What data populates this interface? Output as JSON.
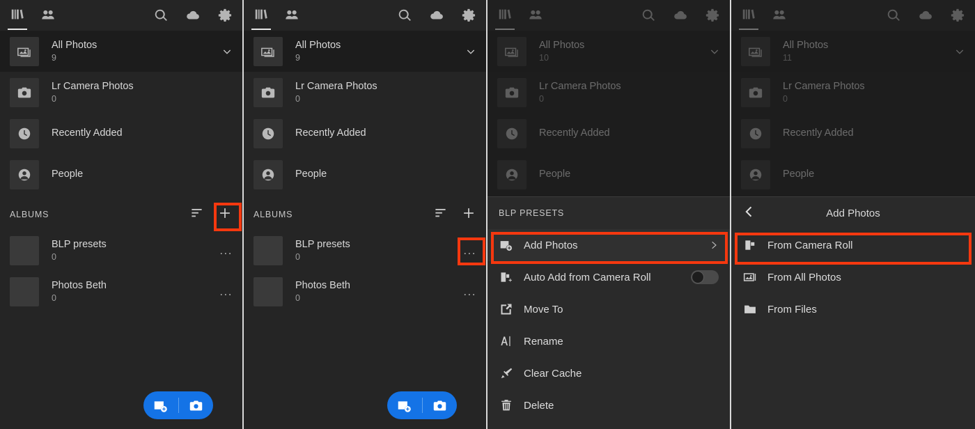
{
  "app": {
    "accent_blue": "#1473e6",
    "annotation_red": "#f5380f",
    "background": "#252525"
  },
  "topbar": {
    "tabs": [
      {
        "name": "library-tab",
        "icon": "library-icon",
        "active": true
      },
      {
        "name": "sharing-tab",
        "icon": "people-icon",
        "active": false
      }
    ],
    "actions": [
      {
        "name": "search-button",
        "icon": "search-icon"
      },
      {
        "name": "cloud-button",
        "icon": "cloud-icon"
      },
      {
        "name": "settings-button",
        "icon": "gear-icon"
      }
    ]
  },
  "panels": [
    {
      "id": "panel-1",
      "dimmed": false,
      "library": {
        "rows": [
          {
            "title": "All Photos",
            "count": "9",
            "icon": "photo-icon",
            "selected": true,
            "expandable": true
          },
          {
            "title": "Lr Camera Photos",
            "count": "0",
            "icon": "camera-icon",
            "selected": false,
            "expandable": false
          },
          {
            "title": "Recently Added",
            "count": "",
            "icon": "clock-icon",
            "selected": false,
            "expandable": false
          },
          {
            "title": "People",
            "count": "",
            "icon": "person-icon",
            "selected": false,
            "expandable": false
          }
        ]
      },
      "albums": {
        "label": "ALBUMS",
        "sort_icon": "sort-icon",
        "add_icon": "plus-icon",
        "items": [
          {
            "title": "BLP presets",
            "count": "0",
            "overflow": "..."
          },
          {
            "title": "Photos Beth",
            "count": "0",
            "overflow": "..."
          }
        ]
      },
      "fab": {
        "add_photos_icon": "add-photo-icon",
        "camera_icon": "camera-icon"
      },
      "highlight": {
        "target": "albums-add-button"
      }
    },
    {
      "id": "panel-2",
      "dimmed": false,
      "library": {
        "rows": [
          {
            "title": "All Photos",
            "count": "9",
            "icon": "photo-icon",
            "selected": true,
            "expandable": true
          },
          {
            "title": "Lr Camera Photos",
            "count": "0",
            "icon": "camera-icon",
            "selected": false,
            "expandable": false
          },
          {
            "title": "Recently Added",
            "count": "",
            "icon": "clock-icon",
            "selected": false,
            "expandable": false
          },
          {
            "title": "People",
            "count": "",
            "icon": "person-icon",
            "selected": false,
            "expandable": false
          }
        ]
      },
      "albums": {
        "label": "ALBUMS",
        "sort_icon": "sort-icon",
        "add_icon": "plus-icon",
        "items": [
          {
            "title": "BLP presets",
            "count": "0",
            "overflow": "..."
          },
          {
            "title": "Photos Beth",
            "count": "0",
            "overflow": "..."
          }
        ]
      },
      "fab": {
        "add_photos_icon": "add-photo-icon",
        "camera_icon": "camera-icon"
      },
      "highlight": {
        "target": "album-overflow-button-blp-presets"
      }
    },
    {
      "id": "panel-3",
      "dimmed": true,
      "library": {
        "rows": [
          {
            "title": "All Photos",
            "count": "10",
            "icon": "photo-icon",
            "selected": true,
            "expandable": true
          },
          {
            "title": "Lr Camera Photos",
            "count": "0",
            "icon": "camera-icon",
            "selected": false,
            "expandable": false
          },
          {
            "title": "Recently Added",
            "count": "",
            "icon": "clock-icon",
            "selected": false,
            "expandable": false
          },
          {
            "title": "People",
            "count": "",
            "icon": "person-icon",
            "selected": false,
            "expandable": false
          }
        ]
      },
      "menu": {
        "title": "BLP PRESETS",
        "items": [
          {
            "label": "Add Photos",
            "icon": "add-photo-icon",
            "trailing": "chevron-right",
            "highlighted": true
          },
          {
            "label": "Auto Add from Camera Roll",
            "icon": "auto-add-camera-roll-icon",
            "trailing": "toggle-off",
            "highlighted": false
          },
          {
            "label": "Move To",
            "icon": "move-to-icon",
            "trailing": "none",
            "highlighted": false
          },
          {
            "label": "Rename",
            "icon": "rename-icon",
            "trailing": "none",
            "highlighted": false
          },
          {
            "label": "Clear Cache",
            "icon": "clear-cache-icon",
            "trailing": "none",
            "highlighted": false
          },
          {
            "label": "Delete",
            "icon": "trash-icon",
            "trailing": "none",
            "highlighted": false
          }
        ]
      },
      "highlight": {
        "target": "menu-item-add-photos"
      }
    },
    {
      "id": "panel-4",
      "dimmed": true,
      "library": {
        "rows": [
          {
            "title": "All Photos",
            "count": "11",
            "icon": "photo-icon",
            "selected": true,
            "expandable": true
          },
          {
            "title": "Lr Camera Photos",
            "count": "0",
            "icon": "camera-icon",
            "selected": false,
            "expandable": false
          },
          {
            "title": "Recently Added",
            "count": "",
            "icon": "clock-icon",
            "selected": false,
            "expandable": false
          },
          {
            "title": "People",
            "count": "",
            "icon": "person-icon",
            "selected": false,
            "expandable": false
          }
        ]
      },
      "submenu": {
        "back_icon": "chevron-left-icon",
        "title": "Add Photos",
        "items": [
          {
            "label": "From Camera Roll",
            "icon": "camera-roll-icon",
            "highlighted": true
          },
          {
            "label": "From All Photos",
            "icon": "photo-icon",
            "highlighted": false
          },
          {
            "label": "From Files",
            "icon": "folder-icon",
            "highlighted": false
          }
        ]
      },
      "highlight": {
        "target": "submenu-item-from-camera-roll"
      }
    }
  ]
}
